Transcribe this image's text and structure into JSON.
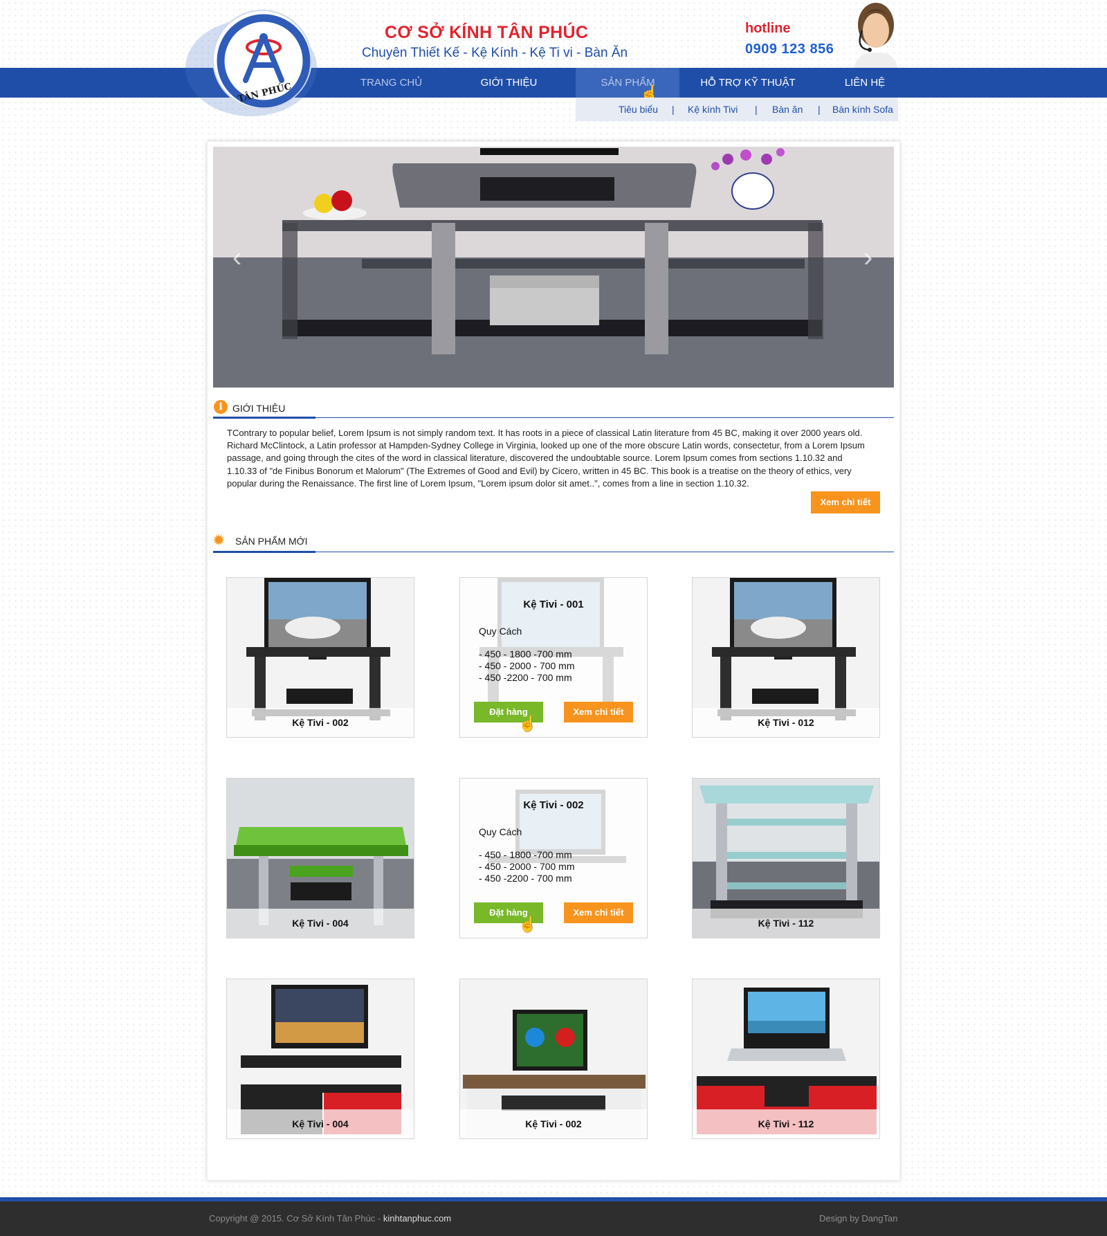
{
  "header": {
    "brand_title": "CƠ SỞ KÍNH TÂN PHÚC",
    "brand_subtitle": "Chuyên Thiết Kế - Kệ Kính - Kệ Ti vi - Bàn Ăn",
    "logo_text": "TÂN PHÚC",
    "hotline_label": "hotline",
    "hotline_number": "0909 123 856"
  },
  "nav": {
    "items": [
      {
        "label": "TRANG CHỦ"
      },
      {
        "label": "GIỚI THIỆU"
      },
      {
        "label": "SẢN PHẨM"
      },
      {
        "label": "HỖ TRỢ KỸ THUẬT"
      },
      {
        "label": "LIÊN HỆ"
      }
    ],
    "active": "SẢN PHẨM",
    "sub_items": [
      {
        "label": "Tiêu biểu"
      },
      {
        "label": "Kệ kính Tivi"
      },
      {
        "label": "Bàn ăn"
      },
      {
        "label": "Bàn kính Sofa"
      }
    ],
    "separator": "|"
  },
  "intro": {
    "heading": "GIỚI THIỆU",
    "icon": "info-icon",
    "text": "TContrary to popular belief, Lorem Ipsum is not simply random text. It has roots in a piece of classical Latin literature from 45 BC, making it over 2000 years old. Richard McClintock, a Latin professor at Hampden-Sydney College in Virginia, looked up one of the more obscure Latin words, consectetur, from a Lorem Ipsum passage, and going through the cites of the word in classical literature, discovered the undoubtable source. Lorem Ipsum comes from sections 1.10.32 and 1.10.33 of \"de Finibus Bonorum et Malorum\" (The Extremes of Good and Evil) by Cicero, written in 45 BC. This book is a treatise on the theory of ethics, very popular during the Renaissance. The first line of Lorem Ipsum, \"Lorem ipsum dolor sit amet..\", comes from a line in section 1.10.32.",
    "more_button": "Xem chi tiết"
  },
  "new_products": {
    "heading": "SẢN PHẨM MỚI",
    "icon": "sun-icon",
    "order_label": "Đặt hàng",
    "detail_label": "Xem chi tiết",
    "spec_title": "Quy Cách",
    "items": [
      {
        "name": "Kệ Tivi - 002",
        "hover": false
      },
      {
        "name": "Kệ Tivi - 001",
        "hover": true,
        "specs": [
          "- 450 - 1800 -700 mm",
          "- 450 - 2000 - 700 mm",
          "- 450 -2200 - 700 mm"
        ]
      },
      {
        "name": "Kệ Tivi - 012",
        "hover": false
      },
      {
        "name": "Kệ Tivi - 004",
        "hover": false
      },
      {
        "name": "Kệ Tivi - 002",
        "hover": true,
        "specs": [
          "- 450 - 1800 -700 mm",
          "- 450 - 2000 - 700 mm",
          "- 450 -2200 - 700 mm"
        ]
      },
      {
        "name": "Kệ Tivi - 112",
        "hover": false
      },
      {
        "name": "Kệ Tivi - 004",
        "hover": false
      },
      {
        "name": "Kệ Tivi - 002",
        "hover": false
      },
      {
        "name": "Kệ Tivi - 112",
        "hover": false
      }
    ]
  },
  "footer": {
    "copyright": "Copyright @ 2015. Cơ Sở Kính Tân Phúc - ",
    "domain": "kinhtanphuc.com",
    "design": "Design by DangTan"
  },
  "colors": {
    "brand_blue": "#1f4ea8",
    "brand_red": "#e3232d",
    "accent_orange": "#f7941e",
    "accent_green": "#79b829",
    "footer_bg": "#2e2e2e"
  }
}
